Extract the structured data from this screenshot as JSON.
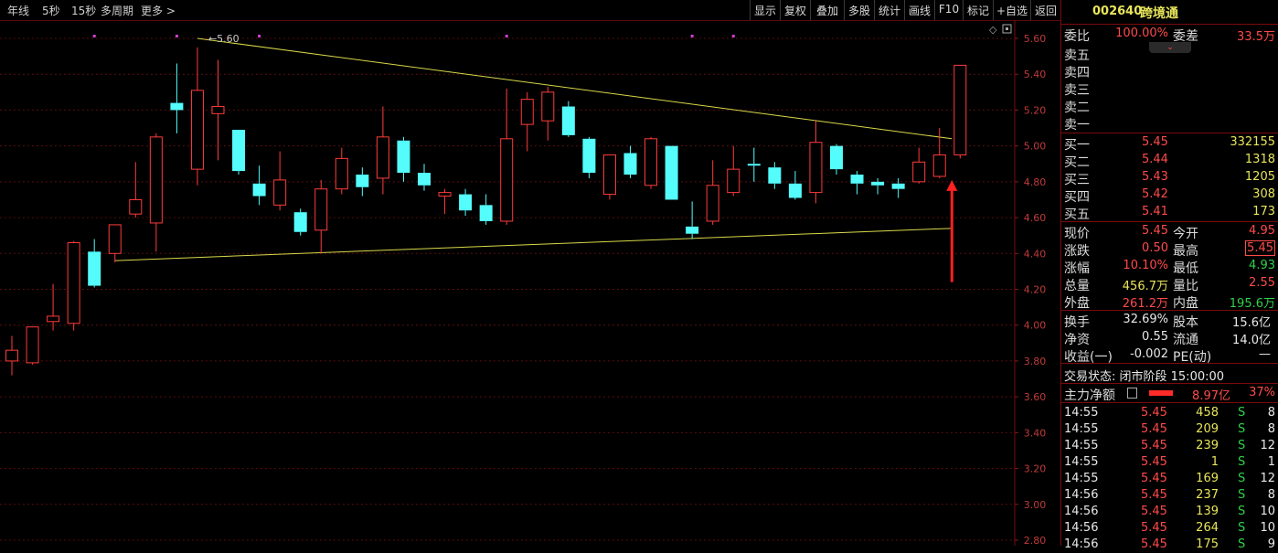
{
  "periods": [
    "年线",
    "5秒",
    "15秒",
    "多周期",
    "更多 >"
  ],
  "toolbar": [
    "显示",
    "复权",
    "叠加",
    "多股",
    "统计",
    "画线",
    "F10",
    "标记",
    "+自选",
    "返回"
  ],
  "chart": {
    "price_min": 2.8,
    "price_max": 5.6,
    "y_ticks": [
      "5.60",
      "5.40",
      "5.20",
      "5.00",
      "4.80",
      "4.60",
      "4.40",
      "4.20",
      "4.00",
      "3.80",
      "3.60",
      "3.40",
      "3.20",
      "3.00",
      "2.80"
    ],
    "high_label": "5.60",
    "candles": [
      {
        "o": 3.8,
        "h": 3.94,
        "l": 3.72,
        "c": 3.86
      },
      {
        "o": 3.79,
        "h": 3.99,
        "l": 3.78,
        "c": 3.99
      },
      {
        "o": 4.02,
        "h": 4.23,
        "l": 3.97,
        "c": 4.05
      },
      {
        "o": 4.01,
        "h": 4.47,
        "l": 3.97,
        "c": 4.46
      },
      {
        "o": 4.41,
        "h": 4.48,
        "l": 4.21,
        "c": 4.22
      },
      {
        "o": 4.4,
        "h": 4.56,
        "l": 4.35,
        "c": 4.56
      },
      {
        "o": 4.62,
        "h": 4.91,
        "l": 4.6,
        "c": 4.7
      },
      {
        "o": 4.57,
        "h": 5.07,
        "l": 4.41,
        "c": 5.05
      },
      {
        "o": 5.24,
        "h": 5.46,
        "l": 5.07,
        "c": 5.2
      },
      {
        "o": 4.87,
        "h": 5.55,
        "l": 4.78,
        "c": 5.31
      },
      {
        "o": 5.18,
        "h": 5.48,
        "l": 4.92,
        "c": 5.22
      },
      {
        "o": 5.09,
        "h": 5.09,
        "l": 4.84,
        "c": 4.86
      },
      {
        "o": 4.79,
        "h": 4.89,
        "l": 4.67,
        "c": 4.72
      },
      {
        "o": 4.67,
        "h": 4.97,
        "l": 4.64,
        "c": 4.81
      },
      {
        "o": 4.63,
        "h": 4.65,
        "l": 4.5,
        "c": 4.52
      },
      {
        "o": 4.53,
        "h": 4.81,
        "l": 4.4,
        "c": 4.76
      },
      {
        "o": 4.76,
        "h": 4.99,
        "l": 4.73,
        "c": 4.93
      },
      {
        "o": 4.84,
        "h": 4.88,
        "l": 4.72,
        "c": 4.77
      },
      {
        "o": 4.82,
        "h": 5.22,
        "l": 4.73,
        "c": 5.05
      },
      {
        "o": 5.03,
        "h": 5.05,
        "l": 4.8,
        "c": 4.85
      },
      {
        "o": 4.85,
        "h": 4.9,
        "l": 4.75,
        "c": 4.78
      },
      {
        "o": 4.72,
        "h": 4.76,
        "l": 4.62,
        "c": 4.74
      },
      {
        "o": 4.73,
        "h": 4.76,
        "l": 4.61,
        "c": 4.64
      },
      {
        "o": 4.67,
        "h": 4.73,
        "l": 4.56,
        "c": 4.58
      },
      {
        "o": 4.58,
        "h": 5.32,
        "l": 4.56,
        "c": 5.04
      },
      {
        "o": 5.12,
        "h": 5.3,
        "l": 4.97,
        "c": 5.26
      },
      {
        "o": 5.14,
        "h": 5.33,
        "l": 5.03,
        "c": 5.3
      },
      {
        "o": 5.22,
        "h": 5.25,
        "l": 5.05,
        "c": 5.06
      },
      {
        "o": 5.04,
        "h": 5.05,
        "l": 4.82,
        "c": 4.85
      },
      {
        "o": 4.73,
        "h": 4.9,
        "l": 4.7,
        "c": 4.95
      },
      {
        "o": 4.96,
        "h": 5.0,
        "l": 4.82,
        "c": 4.84
      },
      {
        "o": 4.78,
        "h": 5.05,
        "l": 4.76,
        "c": 5.04
      },
      {
        "o": 5.0,
        "h": 5.0,
        "l": 4.7,
        "c": 4.7
      },
      {
        "o": 4.55,
        "h": 4.69,
        "l": 4.48,
        "c": 4.51
      },
      {
        "o": 4.58,
        "h": 4.92,
        "l": 4.56,
        "c": 4.78
      },
      {
        "o": 4.74,
        "h": 5.0,
        "l": 4.72,
        "c": 4.87
      },
      {
        "o": 4.9,
        "h": 4.99,
        "l": 4.8,
        "c": 4.89
      },
      {
        "o": 4.88,
        "h": 4.91,
        "l": 4.76,
        "c": 4.79
      },
      {
        "o": 4.79,
        "h": 4.86,
        "l": 4.7,
        "c": 4.71
      },
      {
        "o": 4.74,
        "h": 5.14,
        "l": 4.68,
        "c": 5.02
      },
      {
        "o": 5.0,
        "h": 5.01,
        "l": 4.84,
        "c": 4.87
      },
      {
        "o": 4.84,
        "h": 4.86,
        "l": 4.73,
        "c": 4.79
      },
      {
        "o": 4.8,
        "h": 4.82,
        "l": 4.73,
        "c": 4.78
      },
      {
        "o": 4.79,
        "h": 4.82,
        "l": 4.71,
        "c": 4.76
      },
      {
        "o": 4.8,
        "h": 4.99,
        "l": 4.79,
        "c": 4.91
      },
      {
        "o": 4.83,
        "h": 5.1,
        "l": 4.82,
        "c": 4.95
      },
      {
        "o": 4.95,
        "h": 5.45,
        "l": 4.93,
        "c": 5.45
      }
    ],
    "upper_line": [
      {
        "i": 9,
        "p": 5.6
      },
      {
        "i": 45.6,
        "p": 5.04
      }
    ],
    "lower_line": [
      {
        "i": 5,
        "p": 4.36
      },
      {
        "i": 45.6,
        "p": 4.54
      }
    ],
    "arrow_index": 45.6,
    "arrow_from": 4.24,
    "arrow_to": 4.8,
    "markers": [
      4,
      8,
      12,
      24,
      33,
      35
    ]
  },
  "panel": {
    "code": "002640",
    "name": "跨境通",
    "wb_label": "委比",
    "wb_value": "100.00%",
    "wc_label": "委差",
    "wc_value": "33.5万",
    "sells": [
      "卖五",
      "卖四",
      "卖三",
      "卖二",
      "卖一"
    ],
    "buys": [
      {
        "label": "买一",
        "price": "5.45",
        "vol": "332155"
      },
      {
        "label": "买二",
        "price": "5.44",
        "vol": "1318"
      },
      {
        "label": "买三",
        "price": "5.43",
        "vol": "1205"
      },
      {
        "label": "买四",
        "price": "5.42",
        "vol": "308"
      },
      {
        "label": "买五",
        "price": "5.41",
        "vol": "173"
      }
    ],
    "quote": [
      [
        "现价",
        "5.45",
        "今开",
        "4.95"
      ],
      [
        "涨跌",
        "0.50",
        "最高",
        "5.45"
      ],
      [
        "涨幅",
        "10.10%",
        "最低",
        "4.93"
      ],
      [
        "总量",
        "456.7万",
        "量比",
        "2.55"
      ],
      [
        "外盘",
        "261.2万",
        "内盘",
        "195.6万"
      ]
    ],
    "fund": [
      [
        "换手",
        "32.69%",
        "股本",
        "15.6亿"
      ],
      [
        "净资",
        "0.55",
        "流通",
        "14.0亿"
      ],
      [
        "收益(一)",
        "-0.002",
        "PE(动)",
        "—"
      ]
    ],
    "trade_status": "交易状态: 闭市阶段 15:00:00",
    "main_label": "主力净额",
    "main_value": "8.97亿",
    "main_pct": "37%",
    "ticks": [
      {
        "t": "14:55",
        "p": "5.45",
        "v": "458",
        "s": "S",
        "n": "8"
      },
      {
        "t": "14:55",
        "p": "5.45",
        "v": "209",
        "s": "S",
        "n": "8"
      },
      {
        "t": "14:55",
        "p": "5.45",
        "v": "239",
        "s": "S",
        "n": "12"
      },
      {
        "t": "14:55",
        "p": "5.45",
        "v": "1",
        "s": "S",
        "n": "1"
      },
      {
        "t": "14:55",
        "p": "5.45",
        "v": "169",
        "s": "S",
        "n": "12"
      },
      {
        "t": "14:56",
        "p": "5.45",
        "v": "237",
        "s": "S",
        "n": "8"
      },
      {
        "t": "14:56",
        "p": "5.45",
        "v": "139",
        "s": "S",
        "n": "10"
      },
      {
        "t": "14:56",
        "p": "5.45",
        "v": "264",
        "s": "S",
        "n": "10"
      },
      {
        "t": "14:56",
        "p": "5.45",
        "v": "175",
        "s": "S",
        "n": "9"
      }
    ]
  },
  "colors": {
    "up": "#ff3b3b",
    "down": "#54fcfc",
    "grid": "#5a0d0d",
    "trend": "#d8d84a",
    "marker": "#d040d0"
  }
}
